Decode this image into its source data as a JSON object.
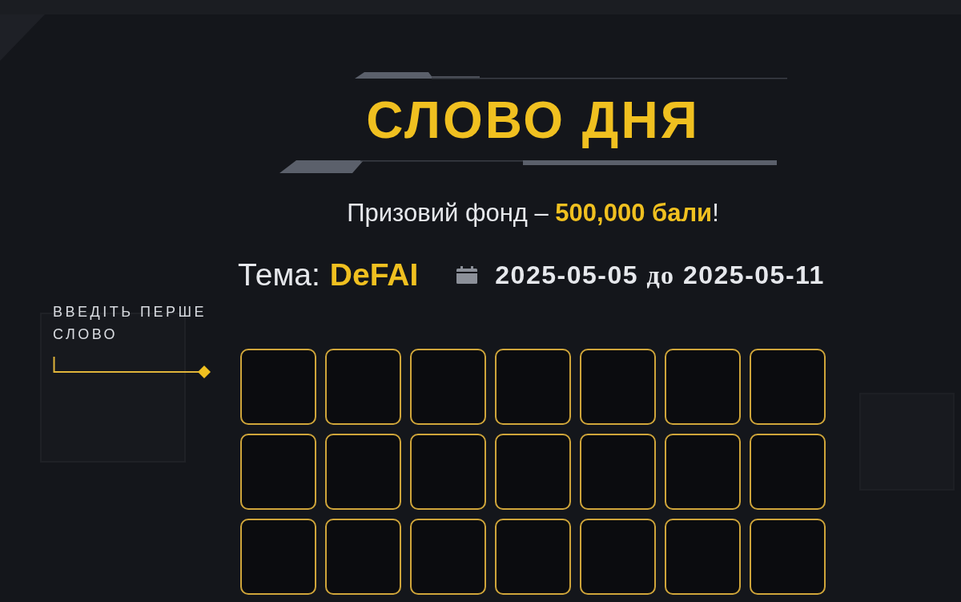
{
  "header": {
    "title": "СЛОВО ДНЯ",
    "prize_text": "Призовий фонд – **500,000 бали**!"
  },
  "topic": {
    "label": "Тема:",
    "value": "DeFAI"
  },
  "date_range": {
    "start": "2025-05-05",
    "connector": "до",
    "end": "2025-05-11"
  },
  "first_word": {
    "prompt": "ВВЕДІТЬ ПЕРШЕ СЛОВО",
    "rows": [
      {
        "cells": [
          {
            "filled": false
          },
          {
            "filled": false
          },
          {
            "filled": false
          },
          {
            "filled": false
          },
          {
            "filled": false
          },
          {
            "filled": false
          },
          {
            "filled": false
          }
        ]
      },
      {
        "cells": [
          {
            "filled": false
          },
          {
            "filled": false
          },
          {
            "filled": false
          },
          {
            "filled": false
          },
          {
            "filled": false
          },
          {
            "filled": false
          },
          {
            "filled": false
          }
        ]
      },
      {
        "cells": [
          {
            "filled": false
          },
          {
            "filled": false
          },
          {
            "filled": false
          },
          {
            "filled": false
          },
          {
            "filled": false
          },
          {
            "filled": false
          },
          {
            "filled": false
          }
        ]
      }
    ]
  }
}
